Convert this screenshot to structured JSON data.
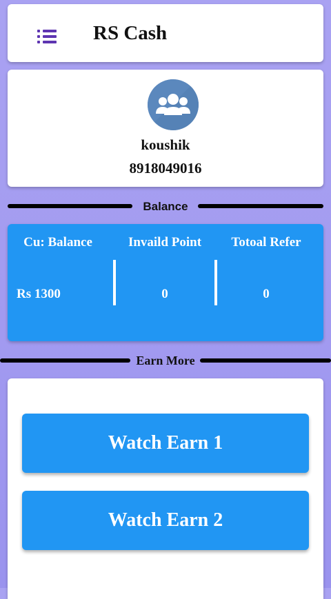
{
  "header": {
    "title": "RS Cash",
    "menu_icon": "menu-list-icon"
  },
  "profile": {
    "avatar_icon": "users-group-icon",
    "name": "koushik",
    "phone": "8918049016"
  },
  "balance_section": {
    "label": "Balance",
    "columns": [
      {
        "header": "Cu: Balance",
        "value": "Rs 1300"
      },
      {
        "header": "Invaild Point",
        "value": "0"
      },
      {
        "header": "Totoal Refer",
        "value": "0"
      }
    ]
  },
  "earn_section": {
    "label": "Earn More",
    "buttons": [
      {
        "label": "Watch Earn 1"
      },
      {
        "label": "Watch Earn 2"
      }
    ]
  },
  "colors": {
    "accent": "#2196f3",
    "menu_icon": "#5e35b1",
    "background": "#a39bf0",
    "avatar": "#5b88bd"
  }
}
